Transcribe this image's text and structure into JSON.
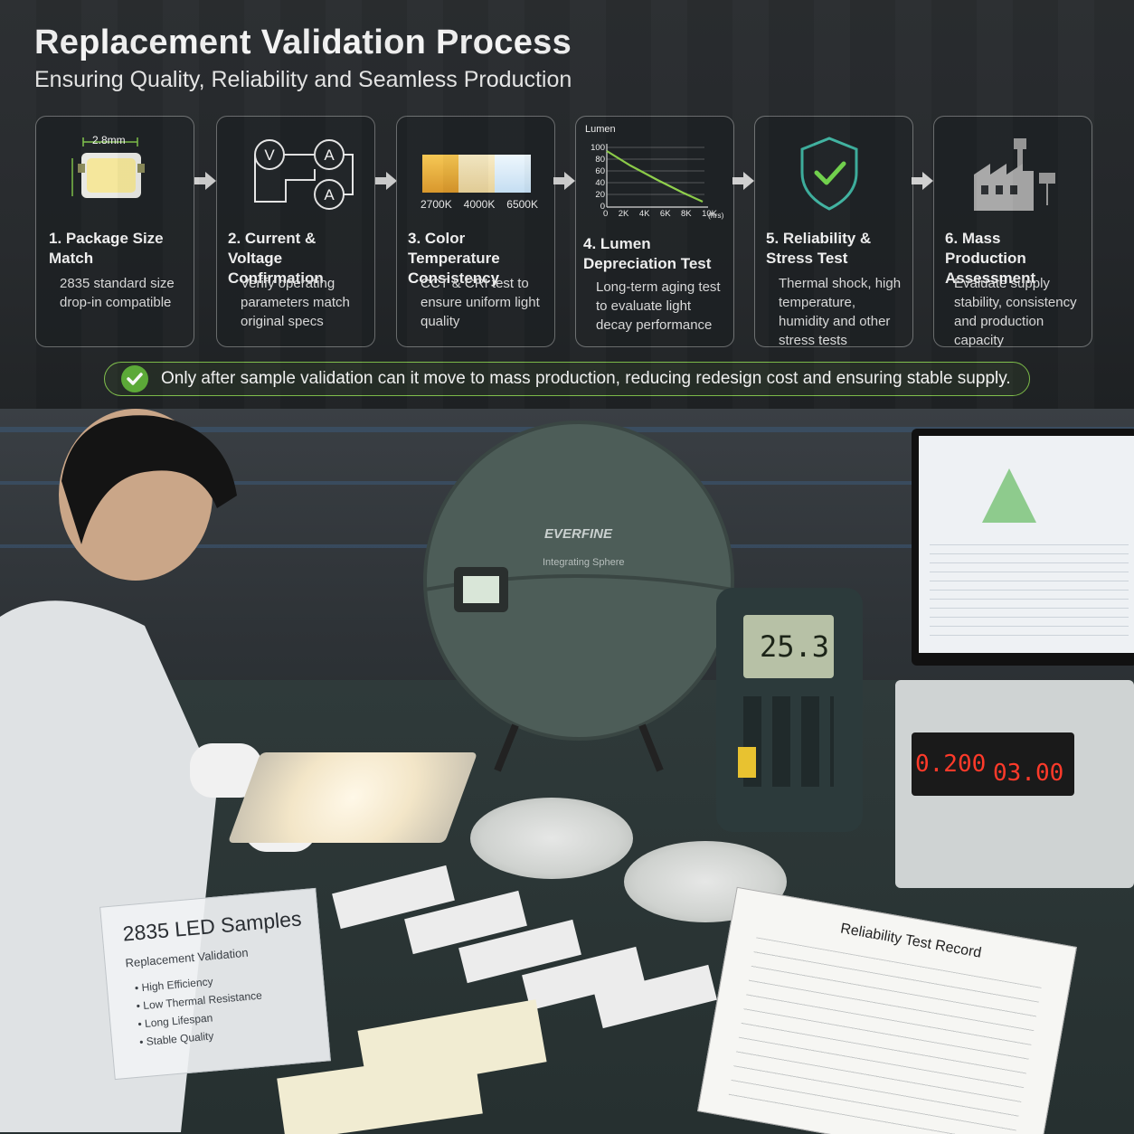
{
  "header": {
    "title": "Replacement Validation Process",
    "subtitle": "Ensuring Quality, Reliability and Seamless Production"
  },
  "steps": [
    {
      "title": "1. Package Size Match",
      "desc": "2835 standard size drop-in compatible",
      "icon": "led-package-icon",
      "dimension_label": "2.8mm"
    },
    {
      "title": "2. Current & Voltage Confirmation",
      "desc": "Verify operating parameters match original specs",
      "icon": "voltmeter-ammeter-circuit-icon",
      "symbols": [
        "V",
        "A",
        "A"
      ]
    },
    {
      "title": "3. Color Temperature Consistency",
      "desc": "CCT & CRI test to ensure uniform light quality",
      "icon": "color-swatch-icon",
      "swatches": [
        {
          "label": "2700K",
          "color": "#f0b73c"
        },
        {
          "label": "4000K",
          "color": "#f5e3b0"
        },
        {
          "label": "6500K",
          "color": "#dbeefa"
        }
      ]
    },
    {
      "title": "4. Lumen Depreciation Test",
      "desc": "Long-term aging test to evaluate light decay performance",
      "icon": "lumen-decay-chart-icon",
      "chart": {
        "ylabel": "Lumen",
        "yticks": [
          "100",
          "80",
          "60",
          "40",
          "20",
          "0"
        ],
        "xticks": [
          "0",
          "2K",
          "4K",
          "6K",
          "8K",
          "10K"
        ],
        "xunit": "(hrs)"
      }
    },
    {
      "title": "5. Reliability & Stress Test",
      "desc": "Thermal shock, high temperature, humidity and other stress tests",
      "icon": "shield-check-icon"
    },
    {
      "title": "6. Mass Production Assessment",
      "desc": "Evaluate supply stability, consistency and production capacity",
      "icon": "factory-icon"
    }
  ],
  "banner": {
    "text": "Only after sample validation can it move to mass production, reducing redesign cost and ensuring stable supply."
  },
  "photo": {
    "sphere_label": "EVERFINE",
    "sphere_sublabel": "Integrating Sphere",
    "meter_reading": "25.3",
    "psu_left": "0.200",
    "psu_right": "03.00",
    "sign_title": "2835 LED Samples",
    "sign_subtitle": "Replacement Validation",
    "sign_items": [
      "High Efficiency",
      "Low Thermal Resistance",
      "Long Lifespan",
      "Stable Quality"
    ],
    "clipboard_title": "Reliability Test Record"
  },
  "colors": {
    "accent_green": "#5fae3a",
    "card_border": "#8a8d90"
  }
}
